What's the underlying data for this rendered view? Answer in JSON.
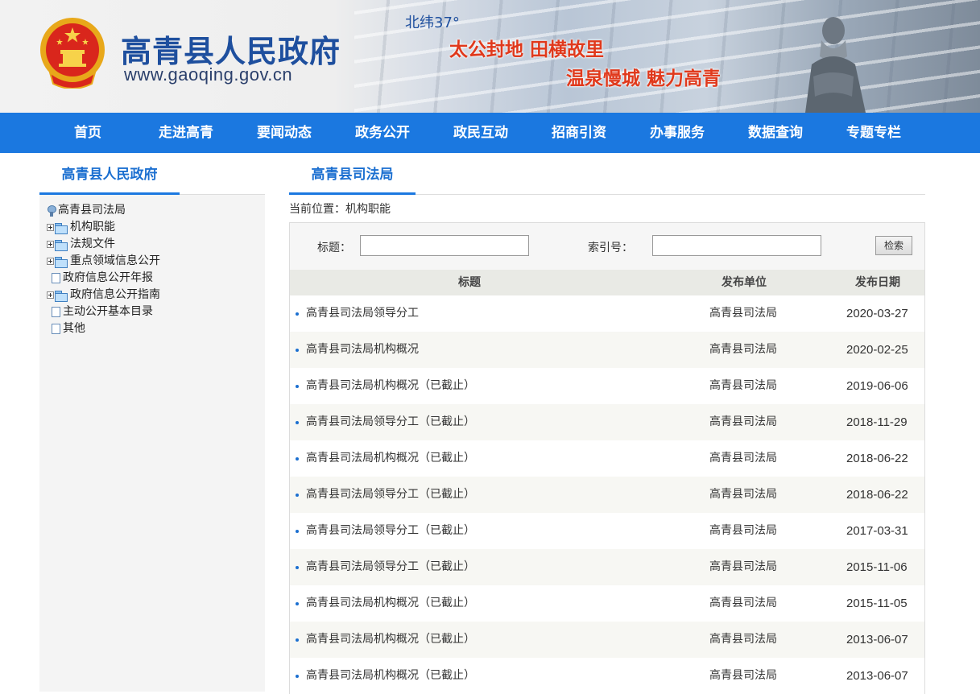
{
  "header": {
    "site_name": "高青县人民政府",
    "site_url": "www.gaoqing.gov.cn",
    "latitude": "北纬37°",
    "slogan_line1": "太公封地  田横故里",
    "slogan_line2": "温泉慢城 魅力高青",
    "emblem_icon": "national-emblem-icon",
    "colors": {
      "brand_blue": "#1e4f9e",
      "slogan_red": "#e0391c"
    }
  },
  "nav": {
    "items": [
      {
        "label": "首页"
      },
      {
        "label": "走进高青"
      },
      {
        "label": "要闻动态"
      },
      {
        "label": "政务公开"
      },
      {
        "label": "政民互动"
      },
      {
        "label": "招商引资"
      },
      {
        "label": "办事服务"
      },
      {
        "label": "数据查询"
      },
      {
        "label": "专题专栏"
      }
    ],
    "color": "#1b78e0"
  },
  "sidebar": {
    "title": "高青县人民政府",
    "tree": {
      "root": "高青县司法局",
      "items": [
        {
          "label": "机构职能",
          "type": "folder"
        },
        {
          "label": "法规文件",
          "type": "folder"
        },
        {
          "label": "重点领域信息公开",
          "type": "folder"
        },
        {
          "label": "政府信息公开年报",
          "type": "document"
        },
        {
          "label": "政府信息公开指南",
          "type": "folder"
        },
        {
          "label": "主动公开基本目录",
          "type": "document"
        },
        {
          "label": "其他",
          "type": "document"
        }
      ]
    }
  },
  "main": {
    "title": "高青县司法局",
    "breadcrumb": "当前位置：机构职能",
    "search": {
      "title_label": "标题：",
      "index_label": "索引号：",
      "title_value": "",
      "index_value": "",
      "button_label": "检索"
    },
    "table": {
      "headers": {
        "title": "标题",
        "unit": "发布单位",
        "date": "发布日期"
      },
      "rows": [
        {
          "title": "高青县司法局领导分工",
          "unit": "高青县司法局",
          "date": "2020-03-27"
        },
        {
          "title": "高青县司法局机构概况",
          "unit": "高青县司法局",
          "date": "2020-02-25"
        },
        {
          "title": "高青县司法局机构概况（已截止）",
          "unit": "高青县司法局",
          "date": "2019-06-06"
        },
        {
          "title": "高青县司法局领导分工（已截止）",
          "unit": "高青县司法局",
          "date": "2018-11-29"
        },
        {
          "title": "高青县司法局机构概况（已截止）",
          "unit": "高青县司法局",
          "date": "2018-06-22"
        },
        {
          "title": "高青县司法局领导分工（已截止）",
          "unit": "高青县司法局",
          "date": "2018-06-22"
        },
        {
          "title": "高青县司法局领导分工（已截止）",
          "unit": "高青县司法局",
          "date": "2017-03-31"
        },
        {
          "title": "高青县司法局领导分工（已截止）",
          "unit": "高青县司法局",
          "date": "2015-11-06"
        },
        {
          "title": "高青县司法局机构概况（已截止）",
          "unit": "高青县司法局",
          "date": "2015-11-05"
        },
        {
          "title": "高青县司法局机构概况（已截止）",
          "unit": "高青县司法局",
          "date": "2013-06-07"
        },
        {
          "title": "高青县司法局机构概况（已截止）",
          "unit": "高青县司法局",
          "date": "2013-06-07"
        }
      ]
    }
  }
}
